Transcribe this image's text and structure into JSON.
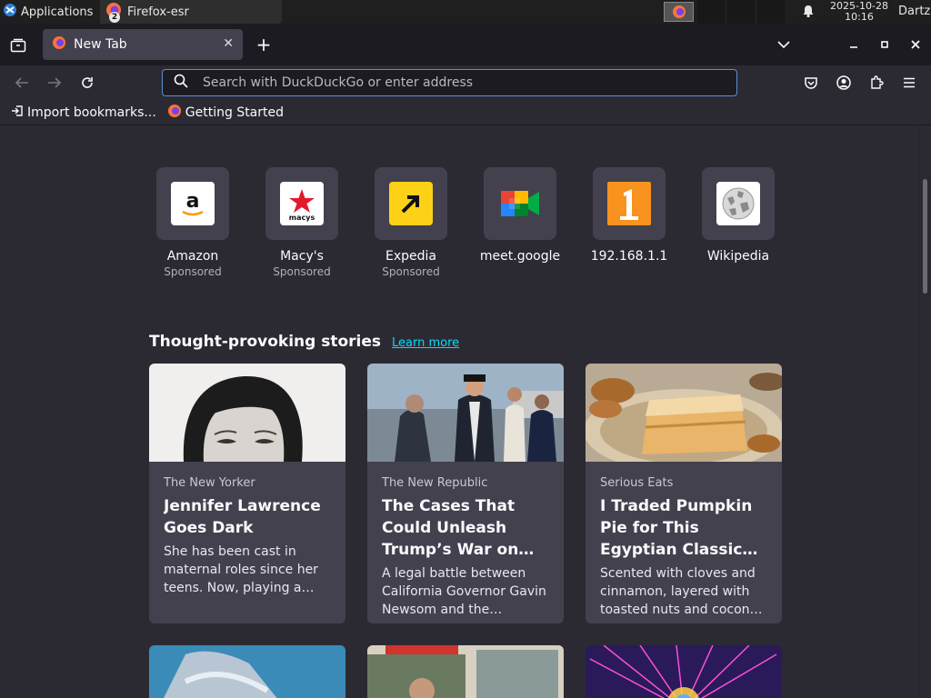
{
  "os_panel": {
    "applications_label": "Applications",
    "window_label": "Firefox-esr",
    "window_count": "2",
    "date": "2025-10-28",
    "time": "10:16",
    "user": "Dartz"
  },
  "tabbar": {
    "tab_title": "New Tab"
  },
  "navbar": {
    "url_placeholder": "Search with DuckDuckGo or enter address"
  },
  "bookmarks": [
    {
      "label": "Import bookmarks..."
    },
    {
      "label": "Getting Started"
    }
  ],
  "top_sites": [
    {
      "name": "Amazon",
      "sponsored": "Sponsored"
    },
    {
      "name": "Macy's",
      "sponsored": "Sponsored"
    },
    {
      "name": "Expedia",
      "sponsored": "Sponsored"
    },
    {
      "name": "meet.google",
      "sponsored": ""
    },
    {
      "name": "192.168.1.1",
      "sponsored": ""
    },
    {
      "name": "Wikipedia",
      "sponsored": ""
    }
  ],
  "stories": {
    "heading": "Thought-provoking stories",
    "learn_more": "Learn more",
    "cards": [
      {
        "publisher": "The New Yorker",
        "title": "Jennifer Lawrence Goes Dark",
        "excerpt": "She has been cast in maternal roles since her teens. Now, playing a…"
      },
      {
        "publisher": "The New Republic",
        "title": "The Cases That Could Unleash Trump’s War on…",
        "excerpt": "A legal battle between California Governor Gavin Newsom and the…"
      },
      {
        "publisher": "Serious Eats",
        "title": "I Traded Pumpkin Pie for This Egyptian Classic…",
        "excerpt": "Scented with cloves and cinnamon, layered with toasted nuts and cocon…"
      }
    ]
  },
  "colors": {
    "accent": "#00ddff",
    "urlbar_border": "#5a90d0",
    "background": "#2b2a33",
    "card": "#42414d"
  }
}
